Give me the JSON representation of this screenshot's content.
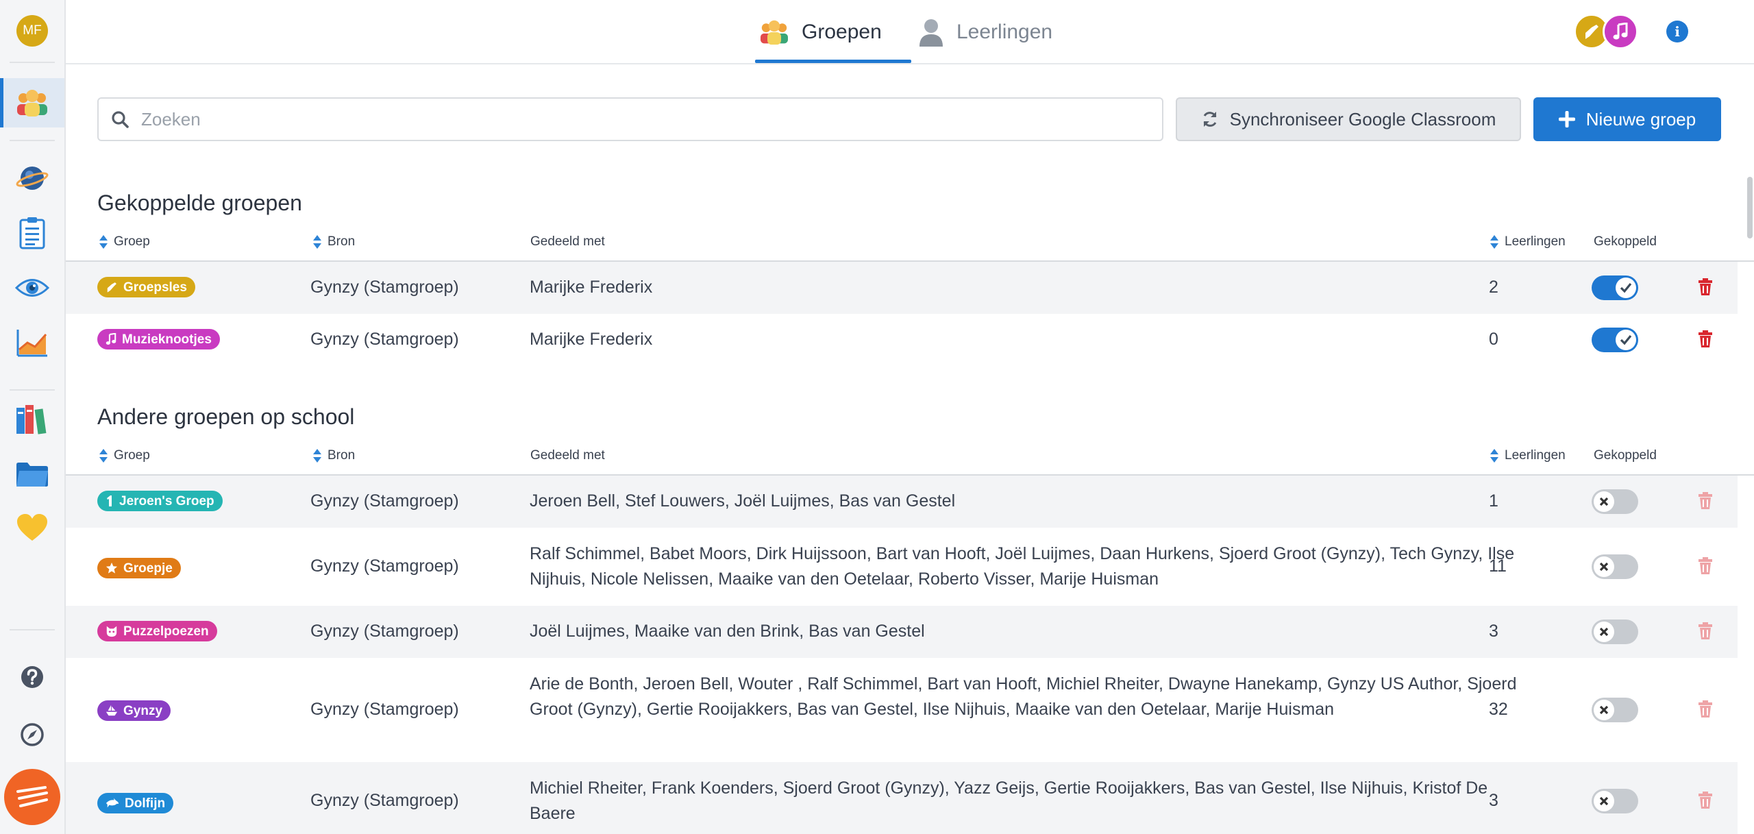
{
  "user": {
    "initials": "MF"
  },
  "tabs": [
    {
      "label": "Groepen",
      "active": true
    },
    {
      "label": "Leerlingen",
      "active": false
    }
  ],
  "toolbar": {
    "search_placeholder": "Zoeken",
    "sync_label": "Synchroniseer Google Classroom",
    "new_group_label": "Nieuwe groep"
  },
  "columns": {
    "group": "Groep",
    "source": "Bron",
    "shared": "Gedeeld met",
    "students": "Leerlingen",
    "linked": "Gekoppeld"
  },
  "linked_section": {
    "title": "Gekoppelde groepen",
    "rows": [
      {
        "group": "Groepsles",
        "icon": "guitar-icon",
        "color": "#d6a816",
        "source": "Gynzy (Stamgroep)",
        "shared": "Marijke Frederix",
        "count": "2",
        "linked": true
      },
      {
        "group": "Muzieknootjes",
        "icon": "music-note-icon",
        "color": "#c93bc1",
        "source": "Gynzy (Stamgroep)",
        "shared": "Marijke Frederix",
        "count": "0",
        "linked": true
      }
    ]
  },
  "other_section": {
    "title": "Andere groepen op school",
    "rows": [
      {
        "group": "Jeroen's Groep",
        "icon": "number-one-icon",
        "color": "#25b5b3",
        "source": "Gynzy (Stamgroep)",
        "shared": "Jeroen Bell, Stef Louwers, Joël Luijmes, Bas van Gestel",
        "count": "1",
        "linked": false
      },
      {
        "group": "Groepje",
        "icon": "star-icon",
        "color": "#e07b16",
        "source": "Gynzy (Stamgroep)",
        "shared": "Ralf Schimmel, Babet Moors, Dirk Huijssoon, Bart van Hooft, Joël Luijmes, Daan Hurkens, Sjoerd Groot (Gynzy), Tech Gynzy, Ilse Nijhuis, Nicole Nelissen, Maaike van den Oetelaar, Roberto Visser, Marije Huisman",
        "count": "11",
        "linked": false
      },
      {
        "group": "Puzzelpoezen",
        "icon": "cat-icon",
        "color": "#d63b9c",
        "source": "Gynzy (Stamgroep)",
        "shared": "Joël Luijmes, Maaike van den Brink, Bas van Gestel",
        "count": "3",
        "linked": false
      },
      {
        "group": "Gynzy",
        "icon": "boat-icon",
        "color": "#8a3fc4",
        "source": "Gynzy (Stamgroep)",
        "shared": "Arie de Bonth, Jeroen Bell, Wouter , Ralf Schimmel, Bart van Hooft, Michiel Rheiter, Dwayne Hanekamp, Gynzy US Author, Sjoerd Groot (Gynzy), Gertie Rooijakkers, Bas van Gestel, Ilse Nijhuis, Maaike van den Oetelaar, Marije Huisman",
        "count": "32",
        "linked": false
      },
      {
        "group": "Dolfijn",
        "icon": "dolphin-icon",
        "color": "#1f8ad6",
        "source": "Gynzy (Stamgroep)",
        "shared": "Michiel Rheiter, Frank Koenders, Sjoerd Groot (Gynzy), Yazz Geijs, Gertie Rooijakkers, Bas van Gestel, Ilse Nijhuis, Kristof De Baere",
        "count": "3",
        "linked": false
      }
    ]
  },
  "colors": {
    "accent": "#1f78d1",
    "danger": "#d9262e",
    "danger_muted": "#eea3a6",
    "brand": "#f06425"
  }
}
